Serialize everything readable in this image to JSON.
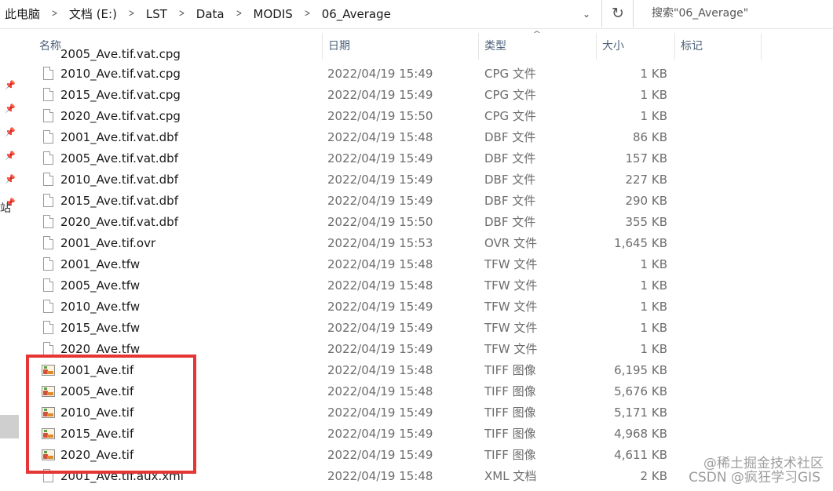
{
  "address_bar": {
    "breadcrumbs": [
      "此电脑",
      "文档 (E:)",
      "LST",
      "Data",
      "MODIS",
      "06_Average"
    ],
    "search_placeholder": "搜索\"06_Average\""
  },
  "columns": [
    {
      "label": "名称"
    },
    {
      "label": "日期"
    },
    {
      "label": "类型"
    },
    {
      "label": "大小"
    },
    {
      "label": "标记"
    }
  ],
  "files": [
    {
      "name": "2010_Ave.tif.vat.cpg",
      "date": "2022/04/19 15:49",
      "type": "CPG 文件",
      "size": "1 KB",
      "icon": "document"
    },
    {
      "name": "2015_Ave.tif.vat.cpg",
      "date": "2022/04/19 15:49",
      "type": "CPG 文件",
      "size": "1 KB",
      "icon": "document"
    },
    {
      "name": "2020_Ave.tif.vat.cpg",
      "date": "2022/04/19 15:50",
      "type": "CPG 文件",
      "size": "1 KB",
      "icon": "document"
    },
    {
      "name": "2001_Ave.tif.vat.dbf",
      "date": "2022/04/19 15:48",
      "type": "DBF 文件",
      "size": "86 KB",
      "icon": "document"
    },
    {
      "name": "2005_Ave.tif.vat.dbf",
      "date": "2022/04/19 15:49",
      "type": "DBF 文件",
      "size": "157 KB",
      "icon": "document"
    },
    {
      "name": "2010_Ave.tif.vat.dbf",
      "date": "2022/04/19 15:49",
      "type": "DBF 文件",
      "size": "227 KB",
      "icon": "document"
    },
    {
      "name": "2015_Ave.tif.vat.dbf",
      "date": "2022/04/19 15:49",
      "type": "DBF 文件",
      "size": "290 KB",
      "icon": "document"
    },
    {
      "name": "2020_Ave.tif.vat.dbf",
      "date": "2022/04/19 15:50",
      "type": "DBF 文件",
      "size": "355 KB",
      "icon": "document"
    },
    {
      "name": "2001_Ave.tif.ovr",
      "date": "2022/04/19 15:53",
      "type": "OVR 文件",
      "size": "1,645 KB",
      "icon": "document"
    },
    {
      "name": "2001_Ave.tfw",
      "date": "2022/04/19 15:48",
      "type": "TFW 文件",
      "size": "1 KB",
      "icon": "document"
    },
    {
      "name": "2005_Ave.tfw",
      "date": "2022/04/19 15:48",
      "type": "TFW 文件",
      "size": "1 KB",
      "icon": "document"
    },
    {
      "name": "2010_Ave.tfw",
      "date": "2022/04/19 15:49",
      "type": "TFW 文件",
      "size": "1 KB",
      "icon": "document"
    },
    {
      "name": "2015_Ave.tfw",
      "date": "2022/04/19 15:49",
      "type": "TFW 文件",
      "size": "1 KB",
      "icon": "document"
    },
    {
      "name": "2020_Ave.tfw",
      "date": "2022/04/19 15:49",
      "type": "TFW 文件",
      "size": "1 KB",
      "icon": "document"
    },
    {
      "name": "2001_Ave.tif",
      "date": "2022/04/19 15:48",
      "type": "TIFF 图像",
      "size": "6,195 KB",
      "icon": "tiff-image"
    },
    {
      "name": "2005_Ave.tif",
      "date": "2022/04/19 15:48",
      "type": "TIFF 图像",
      "size": "5,676 KB",
      "icon": "tiff-image"
    },
    {
      "name": "2010_Ave.tif",
      "date": "2022/04/19 15:49",
      "type": "TIFF 图像",
      "size": "5,171 KB",
      "icon": "tiff-image"
    },
    {
      "name": "2015_Ave.tif",
      "date": "2022/04/19 15:49",
      "type": "TIFF 图像",
      "size": "4,968 KB",
      "icon": "tiff-image"
    },
    {
      "name": "2020_Ave.tif",
      "date": "2022/04/19 15:49",
      "type": "TIFF 图像",
      "size": "4,611 KB",
      "icon": "tiff-image"
    },
    {
      "name": "2001_Ave.tif.aux.xml",
      "date": "2022/04/19 15:48",
      "type": "XML 文档",
      "size": "2 KB",
      "icon": "document"
    }
  ],
  "partial_top_row": {
    "name": "2005_Ave.tif.vat.cpg"
  },
  "left_pane": {
    "partial_label": "站"
  },
  "colors": {
    "highlight_border": "#e53535",
    "header_text": "#4c607a"
  },
  "watermark": {
    "line1": "@稀土掘金技术社区",
    "line2": "CSDN @疯狂学习GIS"
  }
}
